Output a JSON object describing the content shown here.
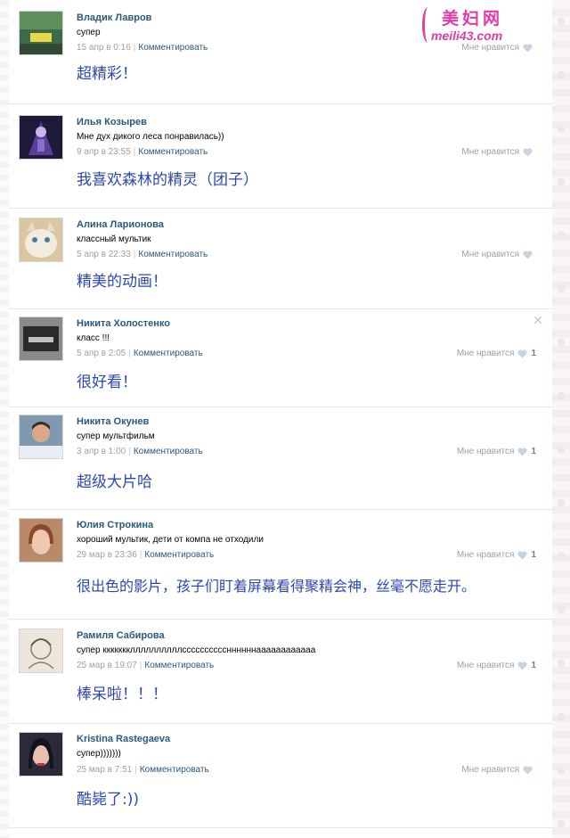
{
  "watermark": {
    "title": "美妇网",
    "url": "meili43.com"
  },
  "comments": [
    {
      "author": "Владик Лавров",
      "text": "супер",
      "date": "15 апр в 0:16",
      "reply": "Комментировать",
      "like_label": "Мне нравится",
      "likes": "",
      "translation": "超精彩！"
    },
    {
      "author": "Илья Козырев",
      "text": "Мне дух дикого леса понравилась))",
      "date": "9 апр в 23:55",
      "reply": "Комментировать",
      "like_label": "Мне нравится",
      "likes": "",
      "translation": "我喜欢森林的精灵（团子）"
    },
    {
      "author": "Алина Ларионова",
      "text": "классный мультик",
      "date": "5 апр в 22:33",
      "reply": "Комментировать",
      "like_label": "Мне нравится",
      "likes": "",
      "translation": "精美的动画！"
    },
    {
      "author": "Никита Холостенко",
      "text": "класс !!!",
      "date": "5 апр в 2:05",
      "reply": "Комментировать",
      "like_label": "Мне нравится",
      "likes": "1",
      "translation": "很好看！"
    },
    {
      "author": "Никита Окунев",
      "text": "супер мультфильм",
      "date": "3 апр в 1:00",
      "reply": "Комментировать",
      "like_label": "Мне нравится",
      "likes": "1",
      "translation": "超级大片哈"
    },
    {
      "author": "Юлия Строкина",
      "text": "хороший мультик, дети от компа не отходили",
      "date": "29 мар в 23:36",
      "reply": "Комментировать",
      "like_label": "Мне нравится",
      "likes": "1",
      "translation": "很出色的影片，孩子们盯着屏幕看得聚精会神，丝毫不愿走开。"
    },
    {
      "author": "Рамиля Сабирова",
      "text": "супер кккккккллллллллллссссссссссннннннаааааааааааа",
      "date": "25 мар в 19:07",
      "reply": "Комментировать",
      "like_label": "Мне нравится",
      "likes": "1",
      "translation": "棒呆啦！！！"
    },
    {
      "author": "Kristina Rastegaeva",
      "text": "супер)))))))",
      "date": "25 мар в 7:51",
      "reply": "Комментировать",
      "like_label": "Мне нравится",
      "likes": "",
      "translation": "酷毙了:))"
    }
  ],
  "colors": {
    "author": "#2b587a",
    "translation": "#2d47b0",
    "watermark": "#e23aa6"
  }
}
